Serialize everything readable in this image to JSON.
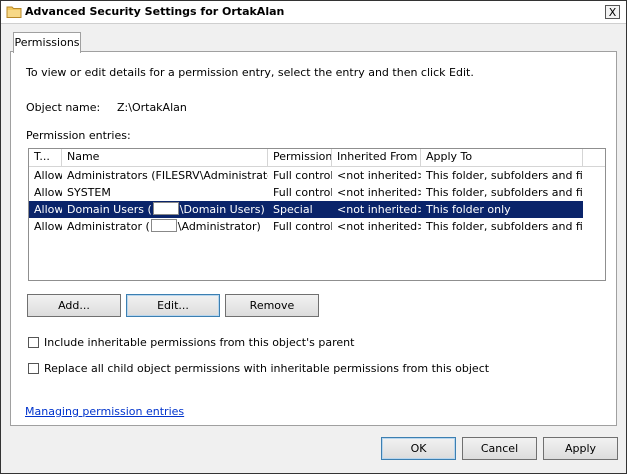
{
  "window": {
    "title": "Advanced Security Settings for OrtakAlan",
    "close_label": "X"
  },
  "tabs": [
    {
      "label": "Permissions"
    }
  ],
  "intro_text": "To view or edit details for a permission entry, select the entry and then click Edit.",
  "object": {
    "label": "Object name:",
    "value": "Z:\\OrtakAlan"
  },
  "entries_label": "Permission entries:",
  "table": {
    "columns": [
      "T...",
      "Name",
      "Permission",
      "Inherited From",
      "Apply To"
    ],
    "rows": [
      {
        "type": "Allow",
        "name_prefix": "Administrators (FILESRV\\Administrators)",
        "name_suffix": "",
        "redacted": false,
        "permission": "Full control",
        "inherited": "<not inherited>",
        "apply": "This folder, subfolders and files",
        "selected": false
      },
      {
        "type": "Allow",
        "name_prefix": "SYSTEM",
        "name_suffix": "",
        "redacted": false,
        "permission": "Full control",
        "inherited": "<not inherited>",
        "apply": "This folder, subfolders and files",
        "selected": false
      },
      {
        "type": "Allow",
        "name_prefix": "Domain Users (",
        "name_suffix": "\\Domain Users)",
        "redacted": true,
        "permission": "Special",
        "inherited": "<not inherited>",
        "apply": "This folder only",
        "selected": true
      },
      {
        "type": "Allow",
        "name_prefix": "Administrator (",
        "name_suffix": "\\Administrator)",
        "redacted": true,
        "permission": "Full control",
        "inherited": "<not inherited>",
        "apply": "This folder, subfolders and files",
        "selected": false
      }
    ]
  },
  "buttons": {
    "add": "Add...",
    "edit": "Edit...",
    "remove": "Remove"
  },
  "checkboxes": {
    "include_inheritable": "Include inheritable permissions from this object's parent",
    "replace_child": "Replace all child object permissions with inheritable permissions from this object"
  },
  "link": "Managing permission entries",
  "footer": {
    "ok": "OK",
    "cancel": "Cancel",
    "apply": "Apply"
  },
  "colors": {
    "selection": "#0a246a",
    "link": "#0033cc"
  },
  "icons": {
    "title": "folder-icon"
  }
}
